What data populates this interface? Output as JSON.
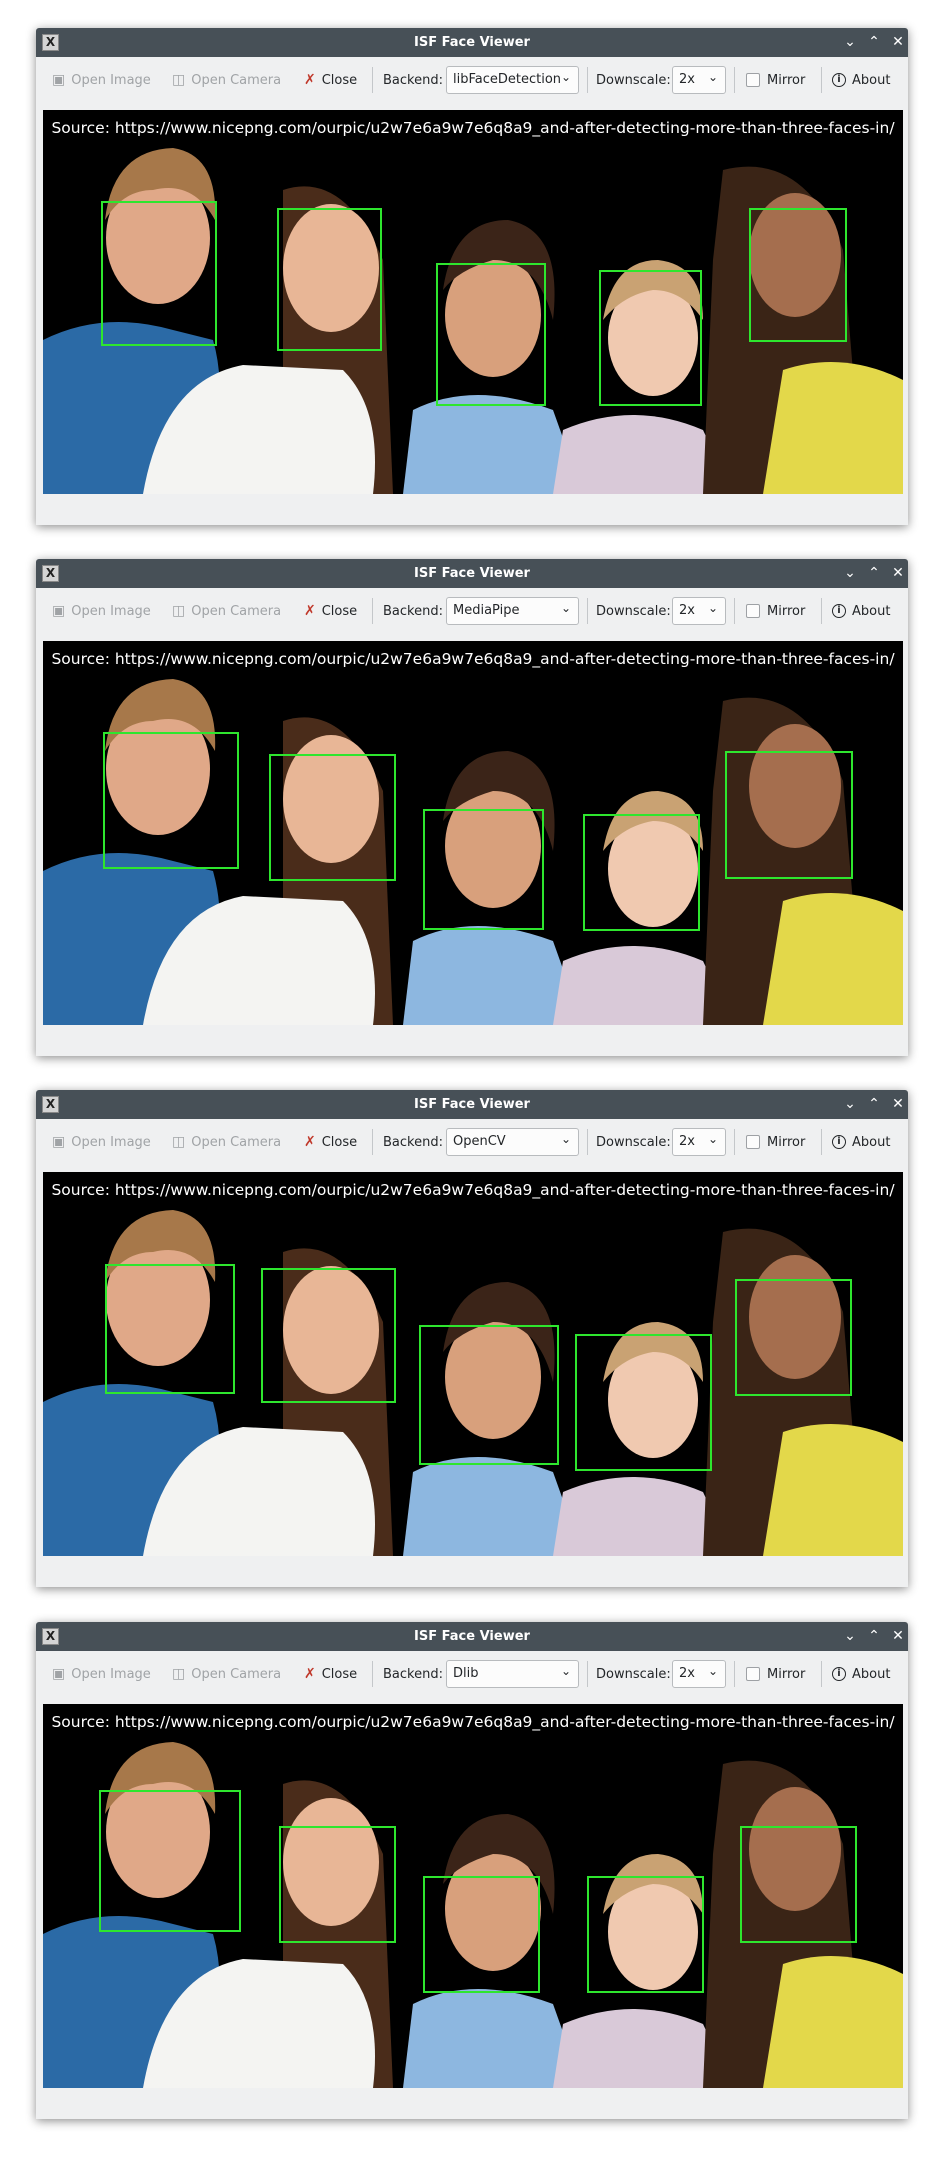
{
  "windows": [
    {
      "title": "ISF Face Viewer",
      "toolbar": {
        "open_image": "Open Image",
        "open_camera": "Open Camera",
        "close": "Close",
        "backend_label": "Backend:",
        "backend_value": "libFaceDetection",
        "downscale_label": "Downscale:",
        "downscale_value": "2x",
        "mirror": "Mirror",
        "mirror_checked": false,
        "about": "About"
      },
      "source_text": "Source: https://www.nicepng.com/ourpic/u2w7e6a9w7e6q8a9_and-after-detecting-more-than-three-faces-in/",
      "faces_detected": 5
    },
    {
      "title": "ISF Face Viewer",
      "toolbar": {
        "open_image": "Open Image",
        "open_camera": "Open Camera",
        "close": "Close",
        "backend_label": "Backend:",
        "backend_value": "MediaPipe",
        "downscale_label": "Downscale:",
        "downscale_value": "2x",
        "mirror": "Mirror",
        "mirror_checked": false,
        "about": "About"
      },
      "source_text": "Source: https://www.nicepng.com/ourpic/u2w7e6a9w7e6q8a9_and-after-detecting-more-than-three-faces-in/",
      "faces_detected": 5
    },
    {
      "title": "ISF Face Viewer",
      "toolbar": {
        "open_image": "Open Image",
        "open_camera": "Open Camera",
        "close": "Close",
        "backend_label": "Backend:",
        "backend_value": "OpenCV",
        "downscale_label": "Downscale:",
        "downscale_value": "2x",
        "mirror": "Mirror",
        "mirror_checked": false,
        "about": "About"
      },
      "source_text": "Source: https://www.nicepng.com/ourpic/u2w7e6a9w7e6q8a9_and-after-detecting-more-than-three-faces-in/",
      "faces_detected": 5
    },
    {
      "title": "ISF Face Viewer",
      "toolbar": {
        "open_image": "Open Image",
        "open_camera": "Open Camera",
        "close": "Close",
        "backend_label": "Backend:",
        "backend_value": "Dlib",
        "downscale_label": "Downscale:",
        "downscale_value": "2x",
        "mirror": "Mirror",
        "mirror_checked": false,
        "about": "About"
      },
      "source_text": "Source: https://www.nicepng.com/ourpic/u2w7e6a9w7e6q8a9_and-after-detecting-more-than-three-faces-in/",
      "faces_detected": 5
    }
  ],
  "icons": {
    "app": "x11-app-icon",
    "minimize": "chevron-down-icon",
    "maximize": "chevron-up-icon",
    "close_window": "close-icon",
    "open_image": "image-icon",
    "open_camera": "camera-icon",
    "close": "disconnect-icon",
    "about": "info-icon"
  },
  "colors": {
    "titlebar": "#475057",
    "window_bg": "#eff0f1",
    "face_box": "#2ee62e",
    "canvas_bg": "#000000"
  }
}
